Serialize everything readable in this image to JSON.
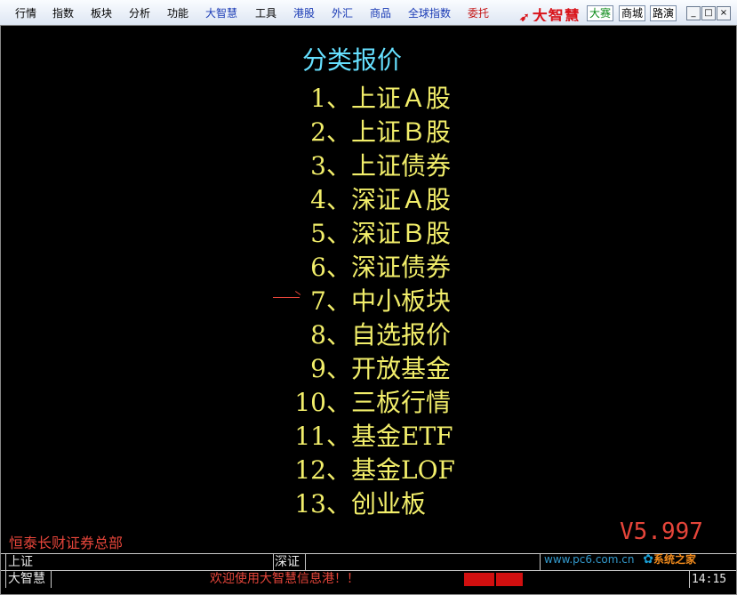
{
  "menubar": {
    "items": [
      {
        "label": "行情",
        "color": "#000000"
      },
      {
        "label": "指数",
        "color": "#000000"
      },
      {
        "label": "板块",
        "color": "#000000"
      },
      {
        "label": "分析",
        "color": "#000000"
      },
      {
        "label": "功能",
        "color": "#000000"
      },
      {
        "label": "大智慧",
        "color": "#1a3bb5"
      },
      {
        "label": "工具",
        "color": "#000000"
      },
      {
        "label": "港股",
        "color": "#1a3bb5"
      },
      {
        "label": "外汇",
        "color": "#1a3bb5"
      },
      {
        "label": "商品",
        "color": "#1a3bb5"
      },
      {
        "label": "全球指数",
        "color": "#1a3bb5"
      },
      {
        "label": "委托",
        "color": "#c41414"
      }
    ],
    "logo_text": "大智慧",
    "buttons": {
      "contest": "大赛",
      "mall": "商城",
      "roadshow": "路演"
    },
    "window_controls": {
      "minimize": "_",
      "maximize": "□",
      "close": "×"
    }
  },
  "main": {
    "title": "分类报价",
    "items": [
      {
        "num": "1、",
        "label": "上证Ａ股"
      },
      {
        "num": "2、",
        "label": "上证Ｂ股"
      },
      {
        "num": "3、",
        "label": "上证债券"
      },
      {
        "num": "4、",
        "label": "深证Ａ股"
      },
      {
        "num": "5、",
        "label": "深证Ｂ股"
      },
      {
        "num": "6、",
        "label": "深证债券"
      },
      {
        "num": "7、",
        "label": "中小板块"
      },
      {
        "num": "8、",
        "label": "自选报价"
      },
      {
        "num": "9、",
        "label": "开放基金"
      },
      {
        "num": "10、",
        "label": "三板行情"
      },
      {
        "num": "11、",
        "label": "基金ETF"
      },
      {
        "num": "12、",
        "label": "基金LOF"
      },
      {
        "num": "13、",
        "label": "创业板"
      }
    ],
    "selected_index": 6,
    "broker": "恒泰长财证券总部",
    "version": "V5.997"
  },
  "status": {
    "row1": {
      "sh_label": "上证",
      "sz_label": "深证"
    },
    "row2": {
      "app_label": "大智慧",
      "ticker": "欢迎使用大智慧信息港！！",
      "time": "14:15"
    },
    "watermark": {
      "url": "www.pc6.com.cn",
      "brand": "系统之家"
    }
  },
  "colors": {
    "background": "#000000",
    "title": "#66e0ff",
    "menu_items": "#f2ee6a",
    "accent_red": "#e6453a"
  }
}
